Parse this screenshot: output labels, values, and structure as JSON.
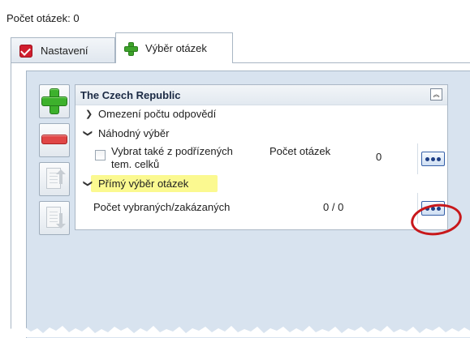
{
  "header": {
    "question_count_label": "Počet otázek: 0"
  },
  "tabs": [
    {
      "label": "Nastavení",
      "icon": "checkbox-checked-icon",
      "active": false
    },
    {
      "label": "Výběr otázek",
      "icon": "plus-icon",
      "active": true
    }
  ],
  "toolbar": {
    "add": {
      "icon": "plus-icon"
    },
    "remove": {
      "icon": "minus-icon"
    },
    "move_up": {
      "icon": "move-up-icon"
    },
    "move_down": {
      "icon": "move-down-icon"
    }
  },
  "group": {
    "title": "The Czech Republic",
    "collapse_icon": "double-chevron-up-icon",
    "rows": {
      "limit": {
        "label": "Omezení počtu odpovědí",
        "expanded": false
      },
      "random": {
        "label": "Náhodný výběr",
        "expanded": true,
        "include_sub_line1": "Vybrat také z podřízených",
        "include_sub_line2": "tem. celků",
        "include_sub_checked": false,
        "count_label": "Počet otázek",
        "count_value": "0"
      },
      "direct": {
        "label": "Přímý výběr otázek",
        "expanded": true,
        "highlighted": true,
        "selected_label": "Počet vybraných/zakázaných",
        "selected_value": "0 / 0"
      }
    }
  },
  "colors": {
    "highlight": "#fbf990",
    "callout": "#c8181b",
    "panel_bg": "#d8e3ef"
  }
}
